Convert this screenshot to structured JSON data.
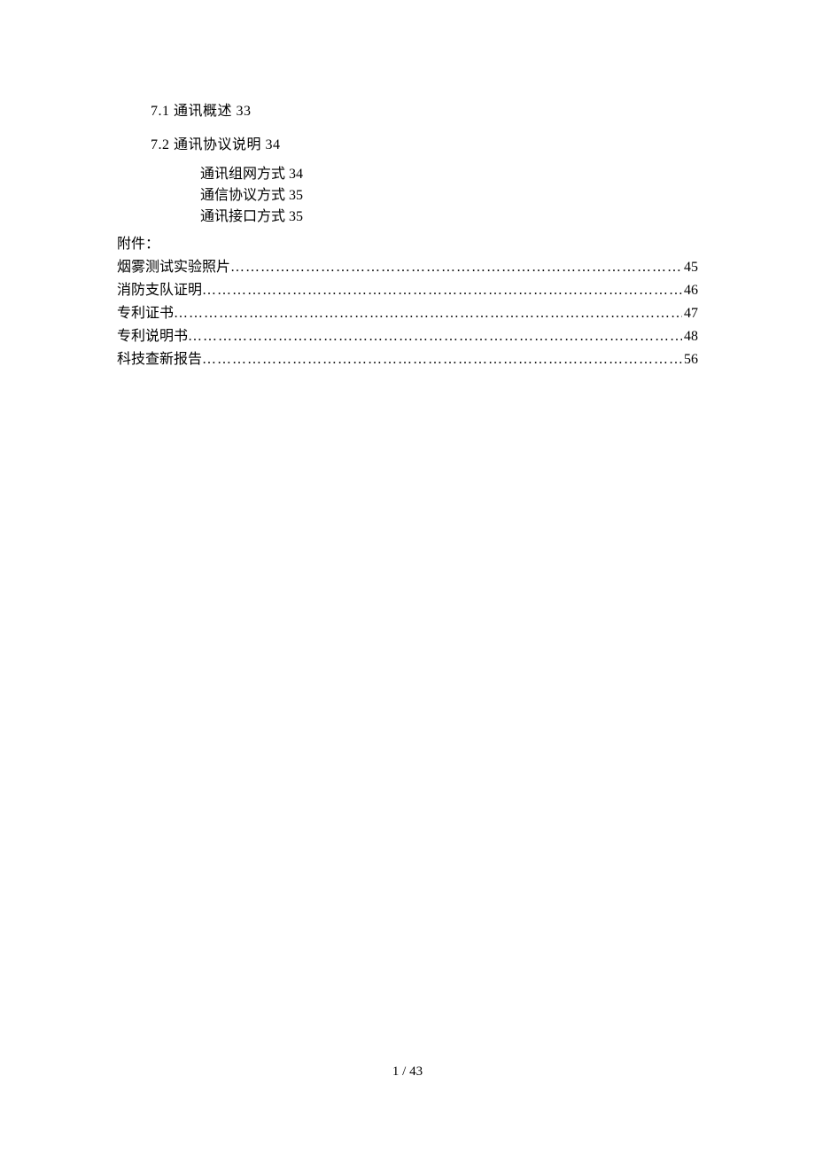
{
  "sections": {
    "s71": {
      "num": "7.1",
      "title": "通讯概述",
      "page": "33"
    },
    "s72": {
      "num": "7.2",
      "title": "通讯协议说明",
      "page": "34"
    }
  },
  "subs": {
    "a": {
      "title": "通讯组网方式",
      "page": "34"
    },
    "b": {
      "title": "通信协议方式",
      "page": "35"
    },
    "c": {
      "title": "通讯接口方式",
      "page": "35"
    }
  },
  "attachments_heading": "附件：",
  "attachments": {
    "0": {
      "label": "烟雾测试实验照片",
      "page": "45"
    },
    "1": {
      "label": "消防支队证明",
      "page": "46"
    },
    "2": {
      "label": "专利证书",
      "page": "47"
    },
    "3": {
      "label": "专利说明书",
      "page": "48"
    },
    "4": {
      "label": "科技查新报告",
      "page": "56"
    }
  },
  "footer": {
    "current": "1",
    "sep": " / ",
    "total": "43"
  }
}
